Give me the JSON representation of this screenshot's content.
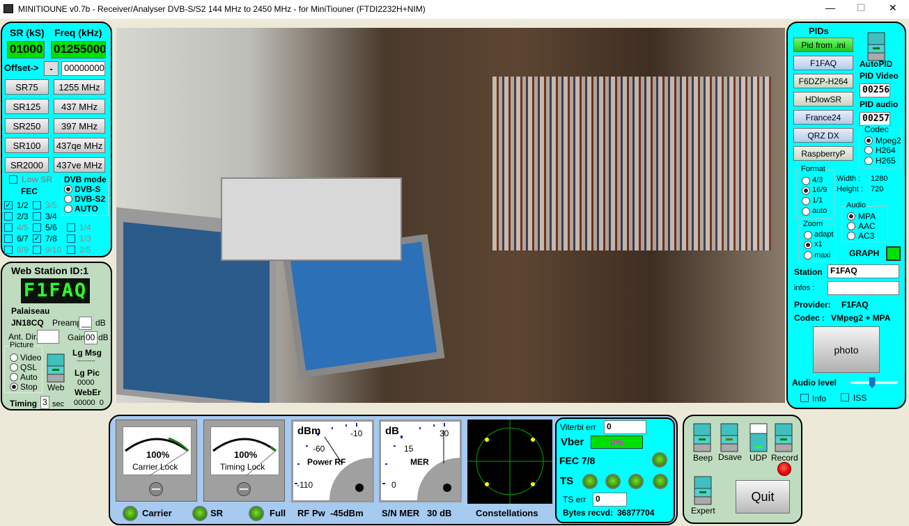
{
  "window": {
    "title": "MINITIOUNE v0.7b - Receiver/Analyser DVB-S/S2 144 MHz to 2450 MHz - for MiniTiouner (FTDI2232H+NIM)",
    "minimize": "—",
    "maximize": "☐",
    "close": "✕"
  },
  "tuning": {
    "sr_label": "SR (kS)",
    "freq_label": "Freq (kHz)",
    "sr_value": "01000",
    "freq_value": "01255000",
    "offset_label": "Offset->",
    "offset_sign": "-",
    "offset_value": "00000000",
    "sr_buttons": [
      "SR75",
      "SR125",
      "SR250",
      "SR100",
      "SR2000"
    ],
    "freq_buttons": [
      "1255 MHz",
      "437 MHz",
      "397 MHz",
      "437qe MHz",
      "437ve MHz"
    ],
    "low_sr": "Low SR",
    "fec_label": "FEC",
    "dvb_mode_label": "DVB mode",
    "dvb_modes": [
      "DVB-S",
      "DVB-S2",
      "AUTO"
    ],
    "dvb_selected": "DVB-S",
    "fec": [
      {
        "label": "1/2",
        "checked": true,
        "enabled": true
      },
      {
        "label": "3/5",
        "checked": false,
        "enabled": false
      },
      {
        "label": "2/3",
        "checked": false,
        "enabled": true
      },
      {
        "label": "3/4",
        "checked": false,
        "enabled": true
      },
      {
        "label": "4/5",
        "checked": false,
        "enabled": false
      },
      {
        "label": "5/6",
        "checked": false,
        "enabled": true
      },
      {
        "label": "1/4",
        "checked": false,
        "enabled": false
      },
      {
        "label": "6/7",
        "checked": false,
        "enabled": true
      },
      {
        "label": "7/8",
        "checked": true,
        "enabled": true
      },
      {
        "label": "1/3",
        "checked": false,
        "enabled": false
      },
      {
        "label": "8/9",
        "checked": false,
        "enabled": false
      },
      {
        "label": "9/10",
        "checked": false,
        "enabled": false
      },
      {
        "label": "2/5",
        "checked": false,
        "enabled": false
      }
    ]
  },
  "web": {
    "title": "Web Station ID:1",
    "callsign": "F1FAQ",
    "city": "Palaiseau",
    "locator": "JN18CQ",
    "preamp": "Preamp",
    "preamp_value": "__",
    "db": "dB",
    "ant_dir": "Ant. Dir.",
    "ant_value": "",
    "gain": "Gain",
    "gain_value": "00",
    "picture_label": "Picture",
    "picture_options": [
      "Video",
      "QSL",
      "Auto",
      "Stop"
    ],
    "picture_selected": "Stop",
    "web_switch": "Web",
    "lg_msg": "Lg Msg",
    "dashes": "----------",
    "lg_pic": "Lg Pic",
    "lg_pic_value": "0000",
    "weber": "WebEr",
    "weber_value": "00000  0",
    "timing": "Timing",
    "timing_value": "3",
    "sec": "sec"
  },
  "pids": {
    "title": "PIDs",
    "buttons": [
      "Pid from .ini",
      "F1FAQ",
      "F6DZP-H264",
      "HDlowSR",
      "France24",
      "QRZ DX",
      "RaspberryP"
    ],
    "autopid": "AutoPID",
    "pid_video_label": "PID Video",
    "pid_video": "00256",
    "pid_audio_label": "PID audio",
    "pid_audio": "00257",
    "codec_label": "Codec",
    "codecs": [
      "Mpeg2",
      "H264",
      "H265"
    ],
    "codec_selected": "Mpeg2",
    "format_label": "Format",
    "formats": [
      "4/3",
      "16/9",
      "1/1",
      "auto"
    ],
    "format_selected": "16/9",
    "width_label": "Width :",
    "width": "1280",
    "height_label": "Height :",
    "height": "720",
    "audio_label": "Audio",
    "audios": [
      "MPA",
      "AAC",
      "AC3"
    ],
    "audio_selected": "MPA",
    "zoom_label": "Zoom",
    "zooms": [
      "adapt",
      "x1",
      "maxi"
    ],
    "zoom_selected": "x1",
    "graph": "GRAPH",
    "station_label": "Station",
    "station": "F1FAQ",
    "infos_label": "infos :",
    "infos": "",
    "provider_label": "Provider:",
    "provider": "F1FAQ",
    "codec_info_label": "Codec :",
    "codec_info": "VMpeg2 + MPA",
    "photo": "photo",
    "audio_level_label": "Audio level",
    "audio_level": 0.45,
    "info_cb": "Info",
    "iss_cb": "ISS"
  },
  "meters": {
    "carrier_pct": "100%",
    "carrier_label": "Carrier Lock",
    "timing_pct": "100%",
    "timing_label": "Timing Lock",
    "rf_unit": "dBm",
    "rf_ticks": [
      "-10",
      "-60",
      "-110"
    ],
    "rf_label": "Power RF",
    "mer_unit": "dB",
    "mer_ticks": [
      "30",
      "15",
      "0"
    ],
    "mer_label": "MER",
    "led_carrier": "Carrier",
    "led_sr": "SR",
    "led_full": "Full",
    "rf_power": "RF Pw  -45dBm",
    "snr": "S/N MER   30 dB",
    "constellations": "Constellations"
  },
  "status": {
    "viterbi_label": "Viterbi err",
    "viterbi": "0",
    "vber_label": "Vber",
    "vber": "0%",
    "fec": "FEC 7/8",
    "ts": "TS",
    "ts_err_label": "TS err",
    "ts_err": "0",
    "bytes_label": "Bytes recvd:",
    "bytes": "36877704"
  },
  "controls": {
    "beep": "Beep",
    "dsave": "Dsave",
    "udp": "UDP",
    "record": "Record",
    "expert": "Expert",
    "quit": "Quit"
  },
  "colors": {
    "panel": "#00ffff",
    "lcd": "#00e000",
    "web_panel": "#c0dcc0",
    "bottom_panel": "#a6caf0"
  }
}
